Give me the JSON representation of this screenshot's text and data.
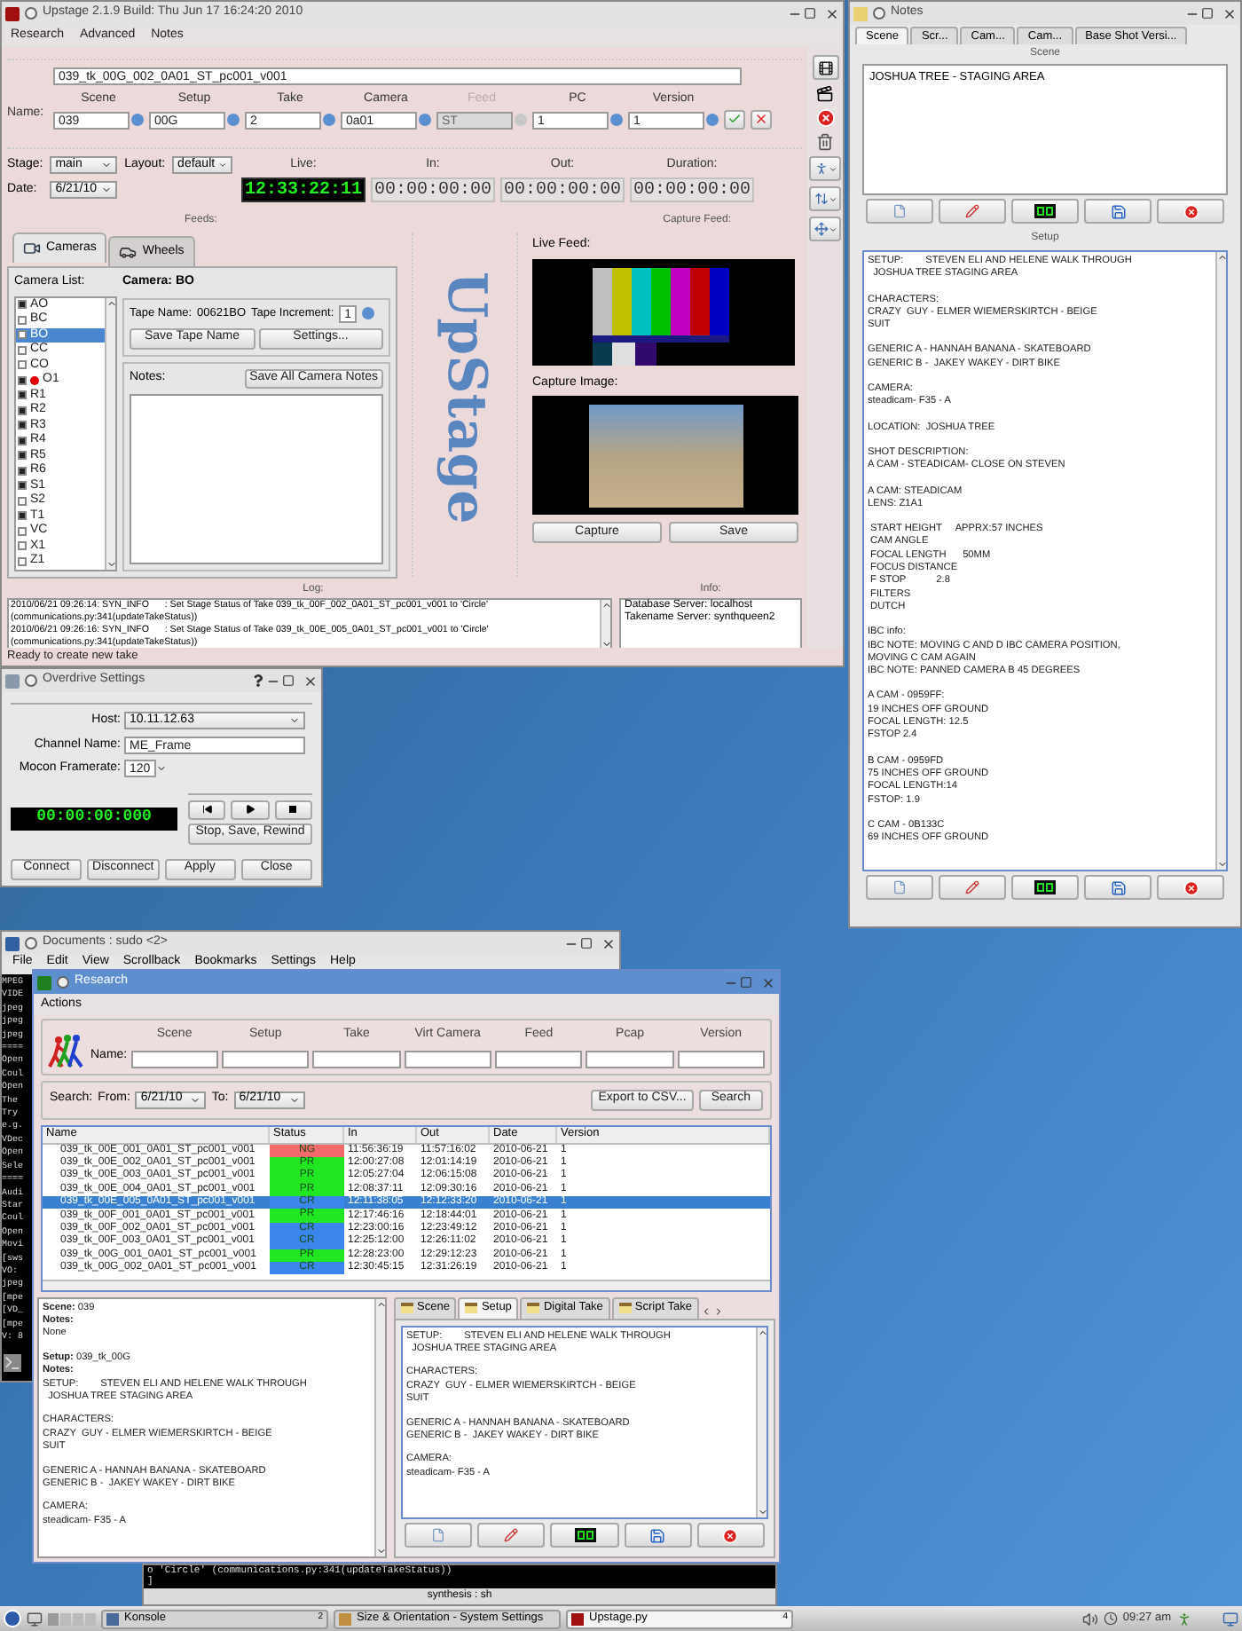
{
  "main_window": {
    "title": "Upstage 2.1.9  Build: Thu Jun 17 16:24:20 2010",
    "menu": [
      "Research",
      "Advanced",
      "Notes"
    ],
    "name_label": "Name:",
    "name_value": "039_tk_00G_002_0A01_ST_pc001_v001",
    "fields": [
      {
        "label": "Scene",
        "value": "039",
        "disabled": false
      },
      {
        "label": "Setup",
        "value": "00G",
        "disabled": false
      },
      {
        "label": "Take",
        "value": "2",
        "disabled": false
      },
      {
        "label": "Camera",
        "value": "0a01",
        "disabled": false
      },
      {
        "label": "Feed",
        "value": "ST",
        "disabled": true
      },
      {
        "label": "PC",
        "value": "1",
        "disabled": false
      },
      {
        "label": "Version",
        "value": "1",
        "disabled": false
      }
    ],
    "stage_label": "Stage:",
    "stage": "main",
    "layout_label": "Layout:",
    "layout": "default",
    "date_label": "Date:",
    "date": "6/21/10",
    "timecodes": [
      {
        "label": "Live:",
        "value": "12:33:22:11",
        "kind": "live"
      },
      {
        "label": "In:",
        "value": "00:00:00:00",
        "kind": "idle"
      },
      {
        "label": "Out:",
        "value": "00:00:00:00",
        "kind": "idle"
      },
      {
        "label": "Duration:",
        "value": "00:00:00:00",
        "kind": "idle"
      }
    ],
    "feeds_label": "Feeds:",
    "capture_feed_label": "Capture Feed:",
    "tabs": [
      {
        "label": "Cameras",
        "selected": true
      },
      {
        "label": "Wheels",
        "selected": false
      }
    ],
    "camera_list_label": "Camera List:",
    "cameras": [
      {
        "label": "AO",
        "checked": true,
        "selected": false,
        "recording": false
      },
      {
        "label": "BC",
        "checked": false,
        "selected": false,
        "recording": false
      },
      {
        "label": "BO",
        "checked": false,
        "selected": true,
        "recording": false
      },
      {
        "label": "CC",
        "checked": false,
        "selected": false,
        "recording": false
      },
      {
        "label": "CO",
        "checked": false,
        "selected": false,
        "recording": false
      },
      {
        "label": "O1",
        "checked": true,
        "selected": false,
        "recording": true
      },
      {
        "label": "R1",
        "checked": true,
        "selected": false,
        "recording": false
      },
      {
        "label": "R2",
        "checked": true,
        "selected": false,
        "recording": false
      },
      {
        "label": "R3",
        "checked": true,
        "selected": false,
        "recording": false
      },
      {
        "label": "R4",
        "checked": true,
        "selected": false,
        "recording": false
      },
      {
        "label": "R5",
        "checked": true,
        "selected": false,
        "recording": false
      },
      {
        "label": "R6",
        "checked": true,
        "selected": false,
        "recording": false
      },
      {
        "label": "S1",
        "checked": true,
        "selected": false,
        "recording": false
      },
      {
        "label": "S2",
        "checked": false,
        "selected": false,
        "recording": false
      },
      {
        "label": "T1",
        "checked": true,
        "selected": false,
        "recording": false
      },
      {
        "label": "VC",
        "checked": false,
        "selected": false,
        "recording": false
      },
      {
        "label": "X1",
        "checked": false,
        "selected": false,
        "recording": false
      },
      {
        "label": "Z1",
        "checked": false,
        "selected": false,
        "recording": false
      }
    ],
    "camera_title": "Camera: BO",
    "tape_name_label": "Tape Name:",
    "tape_name": "00621BO",
    "tape_increment_label": "Tape Increment:",
    "tape_increment": "1",
    "save_tape_button": "Save Tape Name",
    "settings_button": "Settings...",
    "notes_label": "Notes:",
    "save_notes_button": "Save All Camera Notes",
    "logo": "UpStage",
    "live_feed_label": "Live Feed:",
    "capture_image_label": "Capture Image:",
    "capture_button": "Capture",
    "save_button": "Save",
    "log_label": "Log:",
    "info_label": "Info:",
    "log_lines": [
      "2010/06/21 09:26:14: SYN_INFO      : Set Stage Status of Take 039_tk_00F_002_0A01_ST_pc001_v001 to 'Circle'",
      "(communications.py:341(updateTakeStatus))",
      "2010/06/21 09:26:16: SYN_INFO      : Set Stage Status of Take 039_tk_00E_005_0A01_ST_pc001_v001 to 'Circle'",
      "(communications.py:341(updateTakeStatus))"
    ],
    "info_lines": [
      "Database Server: localhost",
      "Takename Server: synthqueen2"
    ],
    "status": "Ready to create new take"
  },
  "overdrive": {
    "title": "Overdrive Settings",
    "host_label": "Host:",
    "host": "10.11.12.63",
    "channel_label": "Channel Name:",
    "channel": "ME_Frame",
    "framerate_label": "Mocon Framerate:",
    "framerate": "120",
    "timecode": "00:00:00:000",
    "stop_save_button": "Stop, Save, Rewind",
    "buttons": [
      "Connect",
      "Disconnect",
      "Apply",
      "Close"
    ]
  },
  "notes": {
    "title": "Notes",
    "tabs": [
      {
        "label": "Scene",
        "selected": true
      },
      {
        "label": "Scr...",
        "selected": false
      },
      {
        "label": "Cam...",
        "selected": false
      },
      {
        "label": "Cam...",
        "selected": false
      },
      {
        "label": "Base Shot Versi...",
        "selected": false
      }
    ],
    "scene_label": "Scene",
    "scene_text": "JOSHUA TREE - STAGING AREA",
    "setup_label": "Setup",
    "setup_text": [
      [
        "SETUP:        STEVEN ELI AND HELENE WALK THROUGH",
        "  JOSHUA TREE STAGING AREA"
      ],
      [
        "CHARACTERS:",
        "CRAZY  GUY - ELMER WIEMERSKIRTCH - BEIGE",
        "SUIT"
      ],
      [
        "GENERIC A - HANNAH BANANA - SKATEBOARD",
        "GENERIC B -  JAKEY WAKEY - DIRT BIKE"
      ],
      [
        "CAMERA:",
        "steadicam- F35 - A"
      ],
      [
        "LOCATION:  JOSHUA TREE"
      ],
      [
        "SHOT DESCRIPTION:",
        "A CAM - STEADICAM- CLOSE ON STEVEN"
      ],
      [
        "A CAM: STEADICAM",
        "LENS: Z1A1"
      ],
      [
        " START HEIGHT     APPRX:57 INCHES",
        " CAM ANGLE",
        " FOCAL LENGTH      50MM",
        " FOCUS DISTANCE",
        " F STOP           2.8",
        " FILTERS",
        " DUTCH"
      ],
      [
        "IBC info:",
        "IBC NOTE: MOVING C AND D IBC CAMERA POSITION,",
        "MOVING C CAM AGAIN",
        "IBC NOTE: PANNED CAMERA B 45 DEGREES"
      ],
      [
        "A CAM - 0959FF:",
        "19 INCHES OFF GROUND",
        "FOCAL LENGTH: 12.5",
        "FSTOP 2.4"
      ],
      [
        "B CAM - 0959FD",
        "75 INCHES OFF GROUND",
        "FOCAL LENGTH:14",
        "FSTOP: 1.9"
      ],
      [
        "C CAM - 0B133C",
        "69 INCHES OFF GROUND"
      ]
    ]
  },
  "konsole": {
    "title": "Documents : sudo <2>",
    "menu": [
      "File",
      "Edit",
      "View",
      "Scrollback",
      "Bookmarks",
      "Settings",
      "Help"
    ],
    "lines": [
      "MPEG",
      "VIDE",
      "jpeg",
      "jpeg",
      "jpeg",
      "====",
      "Open",
      "Coul",
      "Open",
      "The",
      "Try",
      "e.g.",
      "VDec",
      "Open",
      "Sele",
      "====",
      "Audi",
      "Star",
      "Coul",
      "Open",
      "Movi",
      "[sws",
      "VO:",
      "jpeg",
      "[mpe",
      "[VD_",
      "[mpe",
      "V: 8"
    ]
  },
  "research": {
    "title": "Research",
    "menu": [
      "Actions"
    ],
    "name_label": "Name:",
    "name_columns": [
      "Scene",
      "Setup",
      "Take",
      "Virt Camera",
      "Feed",
      "Pcap",
      "Version"
    ],
    "search_label": "Search:",
    "from_label": "From:",
    "from": "6/21/10",
    "to_label": "To:",
    "to": "6/21/10",
    "export_button": "Export to CSV...",
    "search_button": "Search",
    "table": {
      "columns": [
        "Name",
        "Status",
        "In",
        "Out",
        "Date",
        "Version"
      ],
      "rows": [
        {
          "name": "039_tk_00E_001_0A01_ST_pc001_v001",
          "status": "NG",
          "color": "#f26a6a",
          "in": "11:56:36:19",
          "out": "11:57:16:02",
          "date": "2010-06-21",
          "version": "1",
          "selected": false
        },
        {
          "name": "039_tk_00E_002_0A01_ST_pc001_v001",
          "status": "PR",
          "color": "#22e622",
          "in": "12:00:27:08",
          "out": "12:01:14:19",
          "date": "2010-06-21",
          "version": "1",
          "selected": false
        },
        {
          "name": "039_tk_00E_003_0A01_ST_pc001_v001",
          "status": "PR",
          "color": "#22e622",
          "in": "12:05:27:04",
          "out": "12:06:15:08",
          "date": "2010-06-21",
          "version": "1",
          "selected": false
        },
        {
          "name": "039_tk_00E_004_0A01_ST_pc001_v001",
          "status": "PR",
          "color": "#22e622",
          "in": "12:08:37:11",
          "out": "12:09:30:16",
          "date": "2010-06-21",
          "version": "1",
          "selected": false
        },
        {
          "name": "039_tk_00E_005_0A01_ST_pc001_v001",
          "status": "CR",
          "color": "#3a86ea",
          "in": "12:11:38:05",
          "out": "12:12:33:20",
          "date": "2010-06-21",
          "version": "1",
          "selected": true
        },
        {
          "name": "039_tk_00F_001_0A01_ST_pc001_v001",
          "status": "PR",
          "color": "#22e622",
          "in": "12:17:46:16",
          "out": "12:18:44:01",
          "date": "2010-06-21",
          "version": "1",
          "selected": false
        },
        {
          "name": "039_tk_00F_002_0A01_ST_pc001_v001",
          "status": "CR",
          "color": "#3a86ea",
          "in": "12:23:00:16",
          "out": "12:23:49:12",
          "date": "2010-06-21",
          "version": "1",
          "selected": false
        },
        {
          "name": "039_tk_00F_003_0A01_ST_pc001_v001",
          "status": "CR",
          "color": "#3a86ea",
          "in": "12:25:12:00",
          "out": "12:26:11:02",
          "date": "2010-06-21",
          "version": "1",
          "selected": false
        },
        {
          "name": "039_tk_00G_001_0A01_ST_pc001_v001",
          "status": "PR",
          "color": "#22e622",
          "in": "12:28:23:00",
          "out": "12:29:12:23",
          "date": "2010-06-21",
          "version": "1",
          "selected": false
        },
        {
          "name": "039_tk_00G_002_0A01_ST_pc001_v001",
          "status": "CR",
          "color": "#3a86ea",
          "in": "12:30:45:15",
          "out": "12:31:26:19",
          "date": "2010-06-21",
          "version": "1",
          "selected": false
        }
      ]
    },
    "details": [
      [
        {
          "text": "**Scene:** 039",
          "bold": false
        },
        {
          "text": "Notes:",
          "bold": true
        },
        {
          "text": "None",
          "bold": false
        }
      ],
      [
        {
          "text": "**Setup:** 039_tk_00G",
          "bold": false
        },
        {
          "text": "Notes:",
          "bold": true
        },
        {
          "text": "SETUP:        STEVEN ELI AND HELENE WALK THROUGH",
          "bold": false
        },
        {
          "text": "  JOSHUA TREE STAGING AREA",
          "bold": false
        }
      ],
      [
        {
          "text": "CHARACTERS:",
          "bold": false
        },
        {
          "text": "CRAZY  GUY - ELMER WIEMERSKIRTCH - BEIGE",
          "bold": false
        },
        {
          "text": "SUIT",
          "bold": false
        }
      ],
      [
        {
          "text": "GENERIC A - HANNAH BANANA - SKATEBOARD",
          "bold": false
        },
        {
          "text": "GENERIC B -  JAKEY WAKEY - DIRT BIKE",
          "bold": false
        }
      ],
      [
        {
          "text": "CAMERA:",
          "bold": false
        },
        {
          "text": "steadicam- F35 - A",
          "bold": false
        }
      ]
    ],
    "note_tabs": [
      {
        "label": "Scene",
        "selected": false
      },
      {
        "label": "Setup",
        "selected": true
      },
      {
        "label": "Digital Take",
        "selected": false
      },
      {
        "label": "Script Take",
        "selected": false
      }
    ],
    "note_text": [
      [
        "SETUP:        STEVEN ELI AND HELENE WALK THROUGH",
        "  JOSHUA TREE STAGING AREA"
      ],
      [
        "CHARACTERS:",
        "CRAZY  GUY - ELMER WIEMERSKIRTCH - BEIGE",
        "SUIT"
      ],
      [
        "GENERIC A - HANNAH BANANA - SKATEBOARD",
        "GENERIC B -  JAKEY WAKEY - DIRT BIKE"
      ],
      [
        "CAMERA:",
        "steadicam- F35 - A"
      ]
    ]
  },
  "terminal": {
    "line": "o 'Circle' (communications.py:341(updateTakeStatus))",
    "cursor": "]",
    "tab": "synthesis : sh"
  },
  "taskbar": {
    "tasks": [
      {
        "label": "Konsole",
        "count": "2",
        "selected": false
      },
      {
        "label": "Size & Orientation - System Settings",
        "selected": false
      },
      {
        "label": "Upstage.py",
        "count": "4",
        "selected": true
      }
    ],
    "clock": "09:27 am"
  }
}
